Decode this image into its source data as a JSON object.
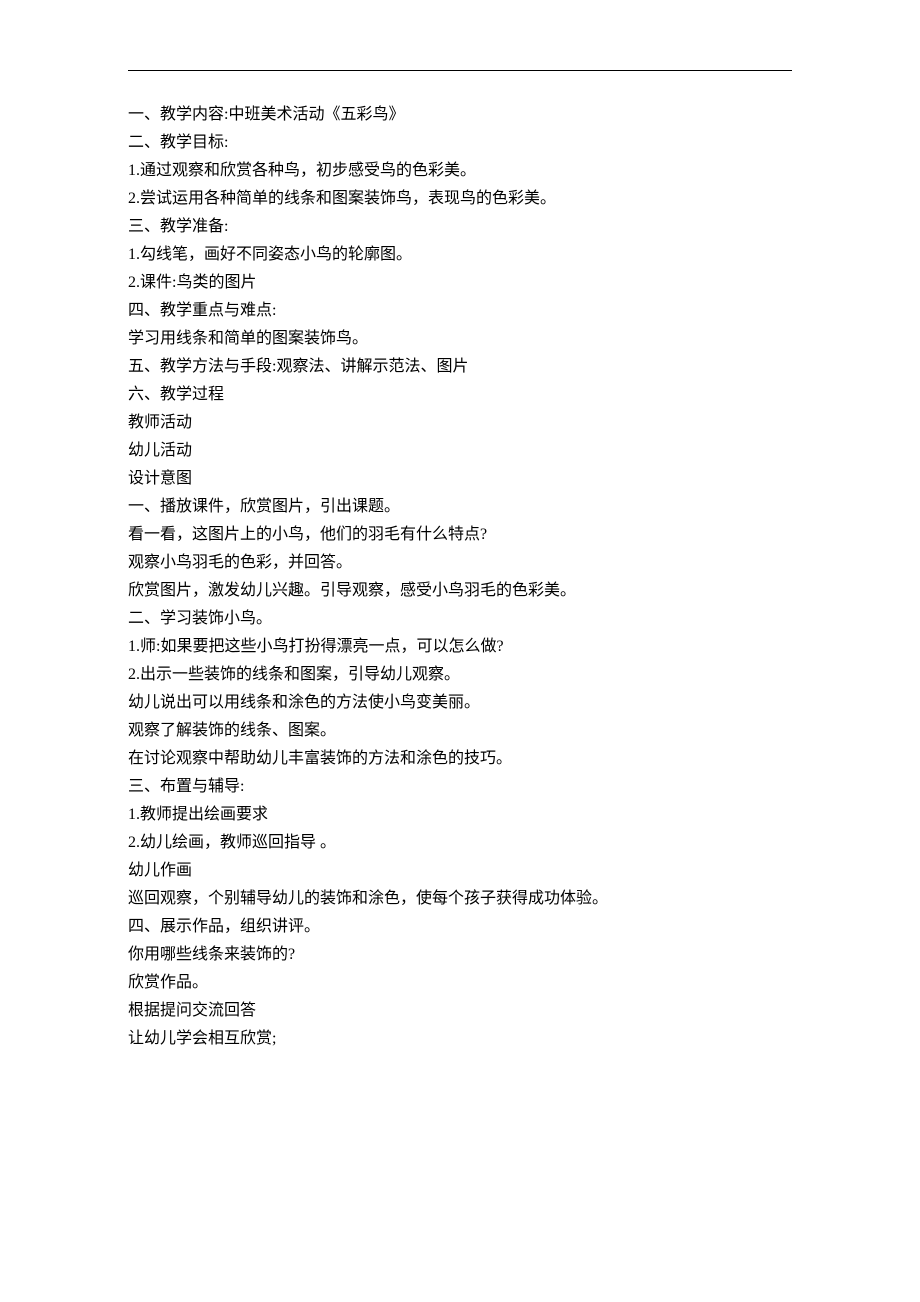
{
  "lines": [
    "一、教学内容:中班美术活动《五彩鸟》",
    "二、教学目标:",
    "1.通过观察和欣赏各种鸟，初步感受鸟的色彩美。",
    "2.尝试运用各种简单的线条和图案装饰鸟，表现鸟的色彩美。",
    "三、教学准备:",
    "1.勾线笔，画好不同姿态小鸟的轮廓图。",
    "2.课件:鸟类的图片",
    "四、教学重点与难点:",
    "学习用线条和简单的图案装饰鸟。",
    "五、教学方法与手段:观察法、讲解示范法、图片",
    "六、教学过程",
    "教师活动",
    "幼儿活动",
    "设计意图",
    "一、播放课件，欣赏图片，引出课题。",
    "看一看，这图片上的小鸟，他们的羽毛有什么特点?",
    "观察小鸟羽毛的色彩，并回答。",
    "欣赏图片，激发幼儿兴趣。引导观察，感受小鸟羽毛的色彩美。",
    "二、学习装饰小鸟。",
    "1.师:如果要把这些小鸟打扮得漂亮一点，可以怎么做?",
    "2.出示一些装饰的线条和图案，引导幼儿观察。",
    "幼儿说出可以用线条和涂色的方法使小鸟变美丽。",
    "观察了解装饰的线条、图案。",
    "在讨论观察中帮助幼儿丰富装饰的方法和涂色的技巧。",
    "三、布置与辅导:",
    "1.教师提出绘画要求",
    "2.幼儿绘画，教师巡回指导 。",
    "幼儿作画",
    "巡回观察，个别辅导幼儿的装饰和涂色，使每个孩子获得成功体验。",
    "四、展示作品，组织讲评。",
    "你用哪些线条来装饰的?",
    "欣赏作品。",
    "根据提问交流回答",
    "让幼儿学会相互欣赏;"
  ]
}
